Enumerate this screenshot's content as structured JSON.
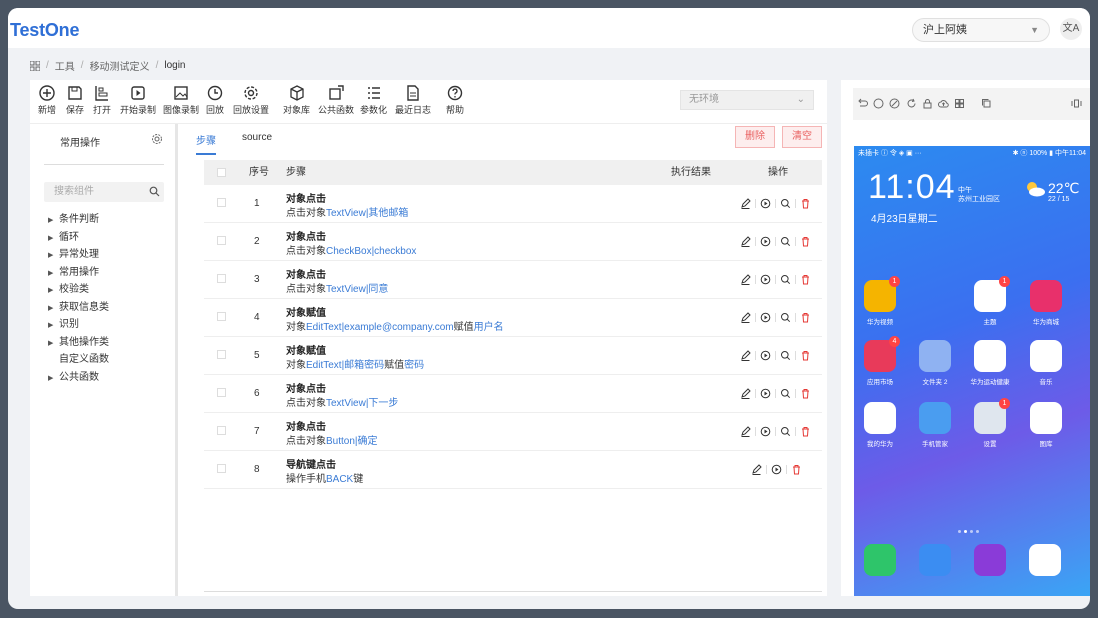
{
  "app": {
    "logo": "TestOne"
  },
  "header": {
    "user": "沪上阿姨",
    "lang_icon": "translate-icon"
  },
  "breadcrumb": {
    "home_icon": "grid-icon",
    "items": [
      "工具",
      "移动测试定义",
      "login"
    ]
  },
  "toolbar": {
    "items": [
      {
        "label": "新增",
        "icon": "plus-circle-icon"
      },
      {
        "label": "保存",
        "icon": "save-icon"
      },
      {
        "label": "打开",
        "icon": "open-icon"
      },
      {
        "label": "开始录制",
        "icon": "play-square-icon"
      },
      {
        "label": "图像录制",
        "icon": "image-icon"
      },
      {
        "label": "回放",
        "icon": "history-icon"
      },
      {
        "label": "回放设置",
        "icon": "gear-icon"
      },
      {
        "label": "对象库",
        "icon": "cube-icon"
      },
      {
        "label": "公共函数",
        "icon": "function-icon"
      },
      {
        "label": "参数化",
        "icon": "list-icon"
      },
      {
        "label": "最近日志",
        "icon": "document-icon"
      },
      {
        "label": "帮助",
        "icon": "help-icon"
      }
    ],
    "env_placeholder": "无环境"
  },
  "sidebar": {
    "title": "常用操作",
    "search_placeholder": "搜索组件",
    "tree": [
      {
        "label": "条件判断",
        "expandable": true
      },
      {
        "label": "循环",
        "expandable": true
      },
      {
        "label": "异常处理",
        "expandable": true
      },
      {
        "label": "常用操作",
        "expandable": true
      },
      {
        "label": "校验类",
        "expandable": true
      },
      {
        "label": "获取信息类",
        "expandable": true
      },
      {
        "label": "识别",
        "expandable": true
      },
      {
        "label": "其他操作类",
        "expandable": true
      },
      {
        "label": "自定义函数",
        "expandable": false
      },
      {
        "label": "公共函数",
        "expandable": true
      }
    ]
  },
  "tabs": [
    {
      "label": "步骤",
      "active": true
    },
    {
      "label": "source",
      "active": false
    }
  ],
  "actions": {
    "delete": "删除",
    "clear": "清空"
  },
  "table": {
    "headers": {
      "index": "序号",
      "step": "步骤",
      "result": "执行结果",
      "ops": "操作"
    },
    "rows": [
      {
        "index": "1",
        "title": "对象点击",
        "parts": [
          {
            "t": "点击对象",
            "link": false
          },
          {
            "t": "TextView|其他邮箱",
            "link": true
          }
        ]
      },
      {
        "index": "2",
        "title": "对象点击",
        "parts": [
          {
            "t": "点击对象",
            "link": false
          },
          {
            "t": "CheckBox|checkbox",
            "link": true
          }
        ]
      },
      {
        "index": "3",
        "title": "对象点击",
        "parts": [
          {
            "t": "点击对象",
            "link": false
          },
          {
            "t": "TextView|同意",
            "link": true
          }
        ]
      },
      {
        "index": "4",
        "title": "对象赋值",
        "parts": [
          {
            "t": "对象",
            "link": false
          },
          {
            "t": "EditText|example@company.com",
            "link": true
          },
          {
            "t": "赋值",
            "link": false
          },
          {
            "t": "用户名",
            "link": true
          }
        ]
      },
      {
        "index": "5",
        "title": "对象赋值",
        "parts": [
          {
            "t": "对象",
            "link": false
          },
          {
            "t": "EditText|邮箱密码",
            "link": true
          },
          {
            "t": "赋值",
            "link": false
          },
          {
            "t": "密码",
            "link": true
          }
        ]
      },
      {
        "index": "6",
        "title": "对象点击",
        "parts": [
          {
            "t": "点击对象",
            "link": false
          },
          {
            "t": "TextView|下一步",
            "link": true
          }
        ]
      },
      {
        "index": "7",
        "title": "对象点击",
        "parts": [
          {
            "t": "点击对象",
            "link": false
          },
          {
            "t": "Button|确定",
            "link": true
          }
        ]
      },
      {
        "index": "8",
        "title": "导航键点击",
        "parts": [
          {
            "t": "操作手机",
            "link": false
          },
          {
            "t": "BACK",
            "link": true
          },
          {
            "t": "键",
            "link": false
          }
        ]
      }
    ]
  },
  "device": {
    "status_left": "未插卡 ⓘ 令 ◈ ▣ ···",
    "status_right": "✱ ⓝ 100% ▮ 中午11:04",
    "time": "11:04",
    "ampm": "中午",
    "location": "苏州工业园区",
    "date": "4月23日星期二",
    "temp": "22℃",
    "temp_range": "22 / 15",
    "apps": [
      {
        "label": "华为视频",
        "badge": "1",
        "color": "#f5b400"
      },
      {
        "label": "主题",
        "badge": "1",
        "color": "#ffffff"
      },
      {
        "label": "华为商城",
        "badge": "",
        "color": "#e8306b"
      },
      {
        "label": "应用市场",
        "badge": "4",
        "color": "#e83a5a"
      },
      {
        "label": "文件夹 2",
        "badge": "",
        "color": "#8fb2f2"
      },
      {
        "label": "华为运动健康",
        "badge": "",
        "color": "#ffffff"
      },
      {
        "label": "音乐",
        "badge": "",
        "color": "#ffffff"
      },
      {
        "label": "我的华为",
        "badge": "",
        "color": "#ffffff"
      },
      {
        "label": "手机管家",
        "badge": "",
        "color": "#4a9df0"
      },
      {
        "label": "设置",
        "badge": "1",
        "color": "#dfe6ee"
      },
      {
        "label": "图库",
        "badge": "",
        "color": "#ffffff"
      }
    ],
    "dock": [
      {
        "name": "phone-app-icon",
        "color": "#2ec56a"
      },
      {
        "name": "messages-app-icon",
        "color": "#3b8df2"
      },
      {
        "name": "browser-app-icon",
        "color": "#8a3bd8"
      },
      {
        "name": "camera-app-icon",
        "color": "#ffffff"
      }
    ]
  }
}
